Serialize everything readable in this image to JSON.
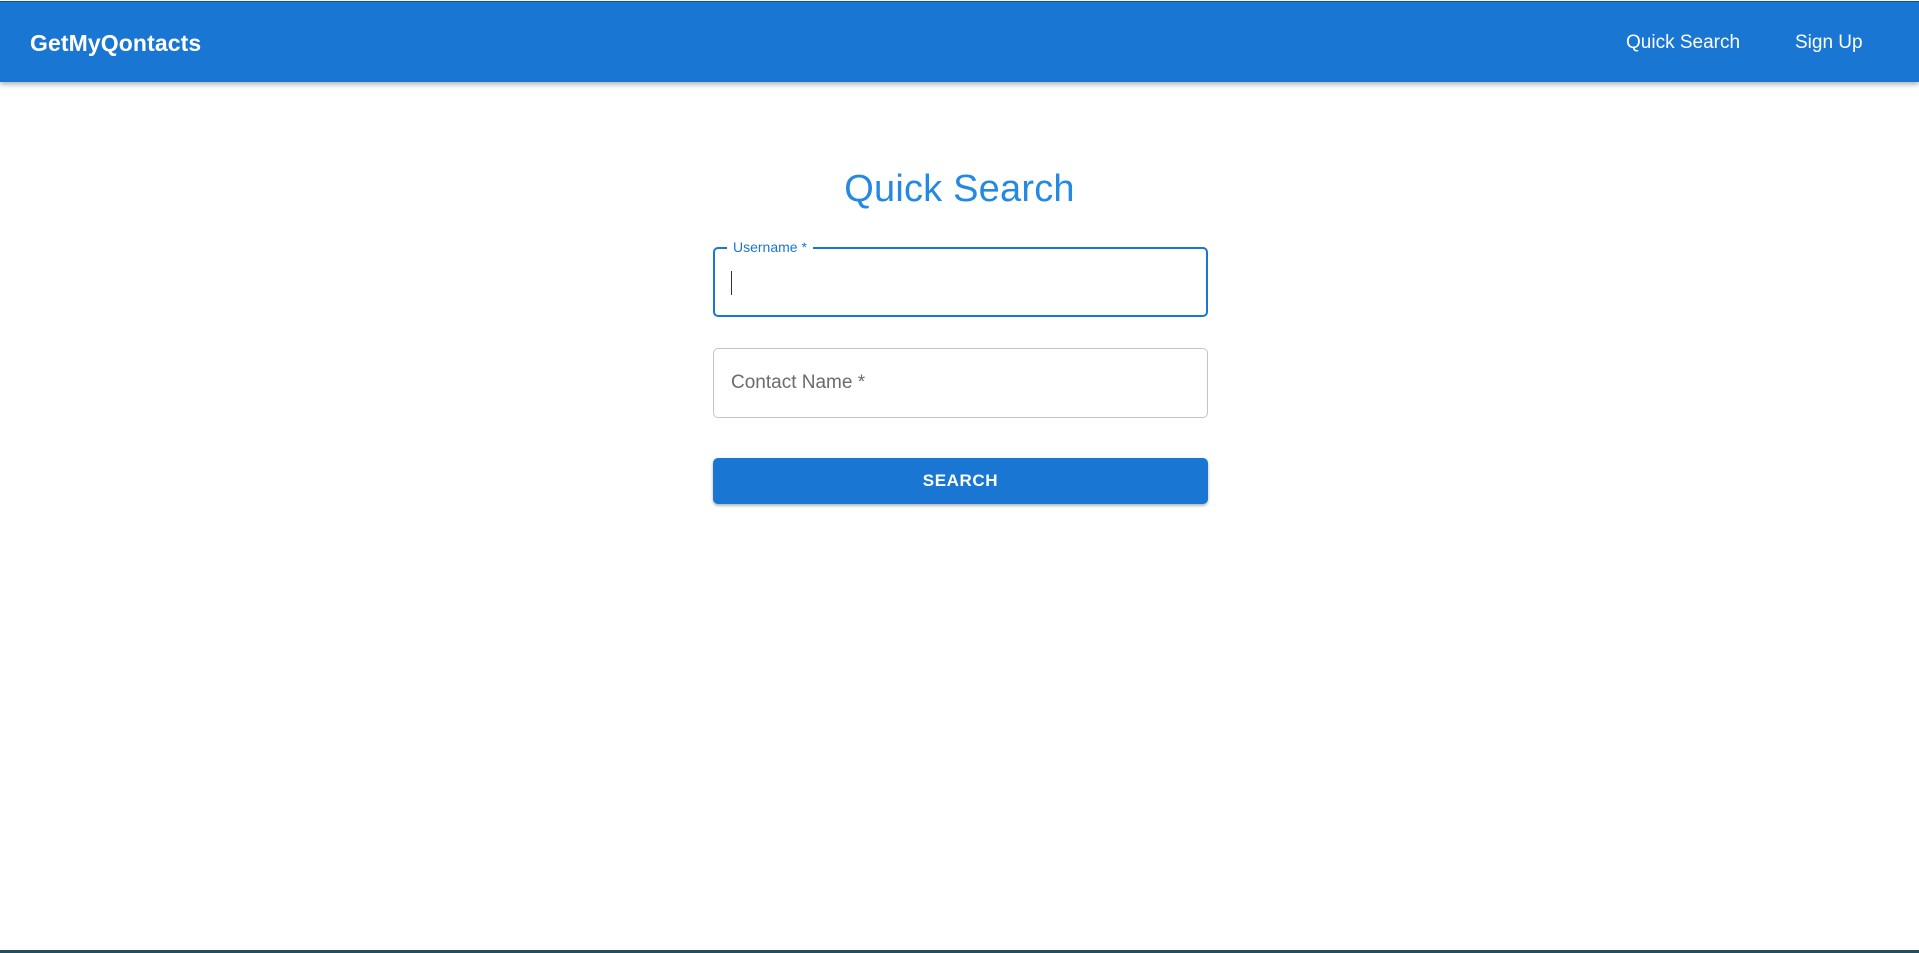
{
  "header": {
    "brand": "GetMyQontacts",
    "nav": {
      "quick_search": "Quick Search",
      "sign_up": "Sign Up"
    }
  },
  "main": {
    "title": "Quick Search",
    "username_field": {
      "label": "Username *",
      "value": ""
    },
    "contact_field": {
      "label": "Contact Name *",
      "value": ""
    },
    "search_button": "SEARCH"
  },
  "colors": {
    "primary": "#1976d2",
    "title": "#2389e2",
    "field_border": "#c4c4c4",
    "background": "#ffffff"
  }
}
